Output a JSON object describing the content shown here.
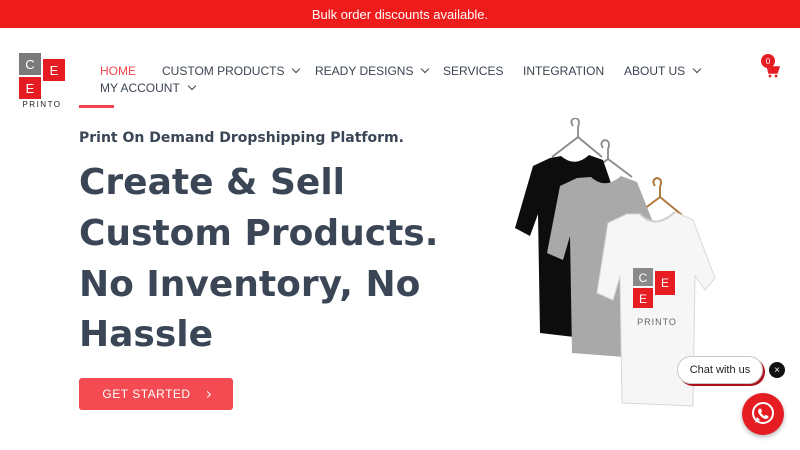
{
  "announcement": {
    "text": "Bulk order discounts available."
  },
  "logo": {
    "letter_c": "C",
    "letter_e_top": "E",
    "letter_e_bottom": "E",
    "wordmark": "PRINTO"
  },
  "nav": {
    "items": [
      {
        "label": "HOME",
        "active": true
      },
      {
        "label": "CUSTOM PRODUCTS",
        "has_dropdown": true
      },
      {
        "label": "READY DESIGNS",
        "has_dropdown": true
      },
      {
        "label": "SERVICES"
      },
      {
        "label": "INTEGRATION"
      },
      {
        "label": "ABOUT US",
        "has_dropdown": true
      },
      {
        "label": "MY ACCOUNT",
        "has_dropdown": true
      }
    ]
  },
  "cart": {
    "count": "0",
    "icon": "cart-icon"
  },
  "hero": {
    "tagline": "Print On Demand Dropshipping Platform.",
    "headline_lines": [
      "Create & Sell",
      "Custom Products.",
      "No Inventory, No",
      "Hassle"
    ],
    "cta_label": "GET STARTED",
    "shirt_logo": {
      "letter_c": "C",
      "letter_e_top": "E",
      "letter_e_bottom": "E",
      "wordmark": "PRINTO"
    }
  },
  "chat": {
    "bubble_text": "Chat with us",
    "close_symbol": "×",
    "icon": "whatsapp-icon"
  },
  "colors": {
    "brand_red": "#ee1b1b",
    "accent": "#f44a52",
    "text": "#3a4655",
    "logo_gray": "#7a7a7a"
  }
}
